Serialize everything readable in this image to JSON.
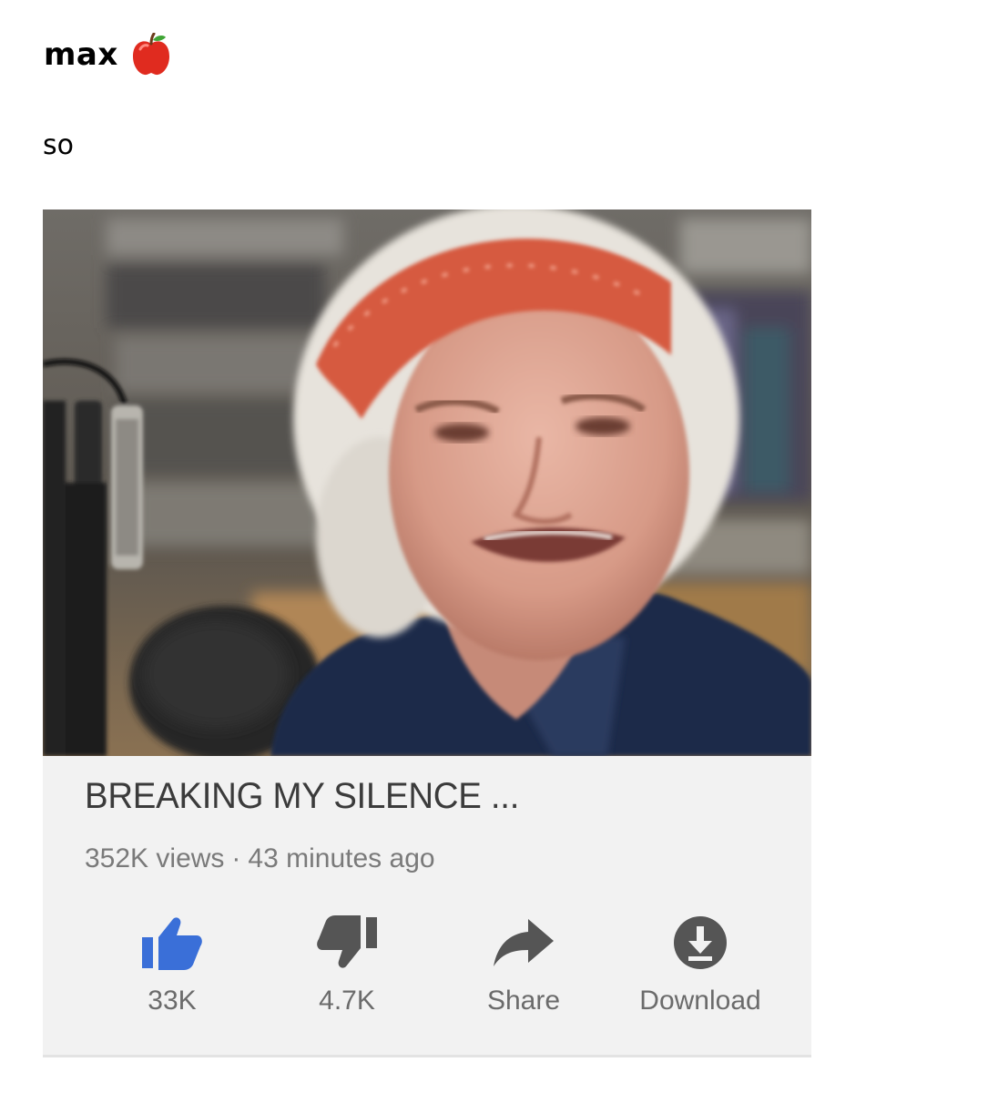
{
  "post": {
    "username": "max",
    "username_emoji": "apple-icon",
    "text": "so"
  },
  "video": {
    "title": "BREAKING MY SILENCE ...",
    "views": "352K views",
    "separator": "·",
    "age": "43 minutes ago",
    "actions": [
      {
        "icon": "thumbs-up-icon",
        "label": "33K",
        "color": "#3a6fd8"
      },
      {
        "icon": "thumbs-down-icon",
        "label": "4.7K",
        "color": "#555555"
      },
      {
        "icon": "share-arrow-icon",
        "label": "Share",
        "color": "#555555"
      },
      {
        "icon": "download-icon",
        "label": "Download",
        "color": "#555555"
      }
    ]
  }
}
